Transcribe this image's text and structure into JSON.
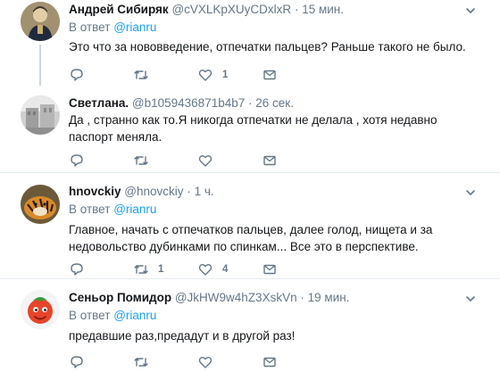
{
  "tweets": [
    {
      "author_name": "Андрей Сибиряк",
      "author_handle": "@cVXLKpXUyCDxlxR",
      "separator": "·",
      "time": "15 мин.",
      "reply_prefix": "В ответ",
      "reply_to": "@rianru",
      "text": "Это что за нововведение, отпечатки пальцев? Раньше такого не было.",
      "reply_count": "",
      "retweet_count": "",
      "like_count": "1",
      "dm_count": ""
    },
    {
      "author_name": "Светлана.",
      "author_handle": "@b1059436871b4b7",
      "separator": "·",
      "time": "26 сек.",
      "text": "Да , странно как то.Я никогда отпечатки не делала , хотя недавно паспорт меняла.",
      "reply_count": "",
      "retweet_count": "",
      "like_count": "",
      "dm_count": ""
    },
    {
      "author_name": "hnovckiy",
      "author_handle": "@hnovckiy",
      "separator": "·",
      "time": "1 ч.",
      "reply_prefix": "В ответ",
      "reply_to": "@rianru",
      "text": "Главное, начать с отпечатков пальцев, далее голод, нищета и за недовольство дубинками по спинкам... Все это в перспективе.",
      "reply_count": "",
      "retweet_count": "1",
      "like_count": "4",
      "dm_count": ""
    },
    {
      "author_name": "Сеньор Помидор",
      "author_handle": "@JkHW9w4hZ3XskVn",
      "separator": "·",
      "time": "19 мин.",
      "reply_prefix": "В ответ",
      "reply_to": "@rianru",
      "text": "предавшие раз,предадут и в другой раз!",
      "reply_count": "",
      "retweet_count": "",
      "like_count": "",
      "dm_count": ""
    }
  ],
  "icons": {
    "reply": "reply-icon",
    "retweet": "retweet-icon",
    "like": "heart-icon",
    "dm": "envelope-icon",
    "more": "chevron-down-icon"
  },
  "colors": {
    "link": "#1da1f2",
    "secondary_text": "#657786",
    "separator": "#e6ecf0",
    "thread_line": "#ccd6dd"
  }
}
